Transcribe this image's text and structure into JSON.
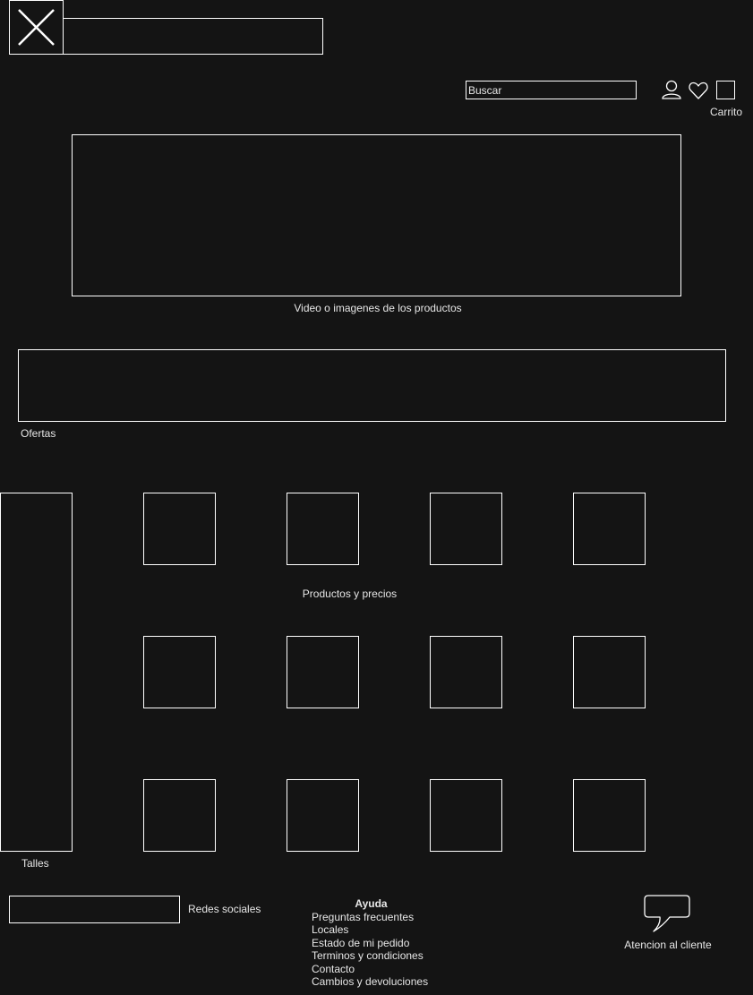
{
  "header": {
    "logo_icon": "close-x-icon",
    "title_box_text": "",
    "search_placeholder": "Buscar",
    "cart_label": "Carrito",
    "icons": [
      "user-icon",
      "heart-icon",
      "cart-icon"
    ]
  },
  "hero": {
    "caption": "Video o imagenes de los productos"
  },
  "offers": {
    "caption": "Ofertas"
  },
  "sizes": {
    "caption": "Talles"
  },
  "products": {
    "caption": "Productos y precios"
  },
  "footer": {
    "social_label": "Redes sociales",
    "help_title": "Ayuda",
    "help_links": [
      "Preguntas frecuentes",
      "Locales",
      "Estado de mi pedido",
      "Terminos y condiciones",
      "Contacto",
      "Cambios y devoluciones"
    ],
    "support_label": "Atencion al cliente",
    "support_icon": "speech-bubble-icon"
  }
}
